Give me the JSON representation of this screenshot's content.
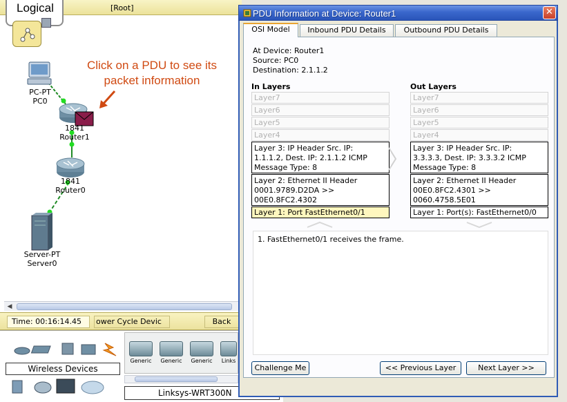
{
  "workspace": {
    "mode_label": "Logical",
    "root_label": "[Root]",
    "annotation": "Click on a PDU to see its packet information",
    "devices": [
      {
        "type": "PC-PT",
        "name": "PC0"
      },
      {
        "type": "1841",
        "name": "Router1"
      },
      {
        "type": "1841",
        "name": "Router0"
      },
      {
        "type": "Server-PT",
        "name": "Server0"
      }
    ]
  },
  "statusbar": {
    "time": "Time: 00:16:14.45",
    "power_cycle": "ower Cycle Devic",
    "back": "Back"
  },
  "palette": {
    "category_label": "Wireless Devices",
    "subdevices": [
      "Generic",
      "Generic",
      "Generic",
      "Links"
    ],
    "model_label": "Linksys-WRT300N"
  },
  "dialog": {
    "title": "PDU Information at Device: Router1",
    "close": "✕",
    "tabs": [
      "OSI Model",
      "Inbound PDU Details",
      "Outbound PDU Details"
    ],
    "at_device": "At Device: Router1",
    "source": "Source: PC0",
    "destination": "Destination: 2.1.1.2",
    "in_layers": {
      "heading": "In Layers",
      "empty": [
        "Layer7",
        "Layer6",
        "Layer5",
        "Layer4"
      ],
      "layer3": [
        "Layer 3: IP Header Src. IP:",
        "1.1.1.2, Dest. IP: 2.1.1.2 ICMP",
        "Message Type: 8"
      ],
      "layer2": [
        "Layer 2: Ethernet II Header",
        "0001.9789.D2DA >>",
        "00E0.8FC2.4302"
      ],
      "layer1": "Layer 1: Port FastEthernet0/1"
    },
    "out_layers": {
      "heading": "Out Layers",
      "empty": [
        "Layer7",
        "Layer6",
        "Layer5",
        "Layer4"
      ],
      "layer3": [
        "Layer 3: IP Header Src. IP:",
        "3.3.3.3, Dest. IP: 3.3.3.2 ICMP",
        "Message Type: 8"
      ],
      "layer2": [
        "Layer 2: Ethernet II Header",
        "00E0.8FC2.4301 >>",
        "0060.4758.5E01"
      ],
      "layer1": "Layer 1: Port(s): FastEthernet0/0"
    },
    "description": "1. FastEthernet0/1 receives the frame.",
    "buttons": {
      "challenge": "Challenge Me",
      "previous": "<< Previous Layer",
      "next": "Next Layer >>"
    }
  },
  "colors": {
    "title_bar": "#2a55b9",
    "annotation": "#d04a12",
    "link": "#1fcc2a",
    "highlight_layer": "#fff7be"
  }
}
